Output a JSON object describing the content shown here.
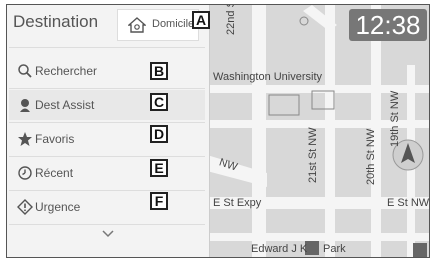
{
  "header": {
    "title": "Destination",
    "home_label": "Domicile"
  },
  "clock": "12:38",
  "menu": {
    "items": [
      {
        "label": "Rechercher",
        "icon": "search-icon",
        "callout": "B"
      },
      {
        "label": "Dest Assist",
        "icon": "assistant-icon",
        "callout": "C"
      },
      {
        "label": "Favoris",
        "icon": "star-icon",
        "callout": "D"
      },
      {
        "label": "Récent",
        "icon": "clock-icon",
        "callout": "E"
      },
      {
        "label": "Urgence",
        "icon": "warning-diamond-icon",
        "callout": "F"
      }
    ]
  },
  "callouts": {
    "home": "A"
  },
  "map": {
    "labels": {
      "street_22nd": "22nd S",
      "university": "Washington University",
      "street_21st": "21st St NW",
      "street_20th": "20th St NW",
      "street_19th": "19th St NW",
      "nw": "NW",
      "e_st_expy": "E St Expy",
      "e_st_nw": "E St NW",
      "park": "Edward J K",
      "park_suffix": "Park"
    }
  },
  "colors": {
    "accent_gray": "#777777",
    "panel_bg": "#f3f3f3"
  }
}
